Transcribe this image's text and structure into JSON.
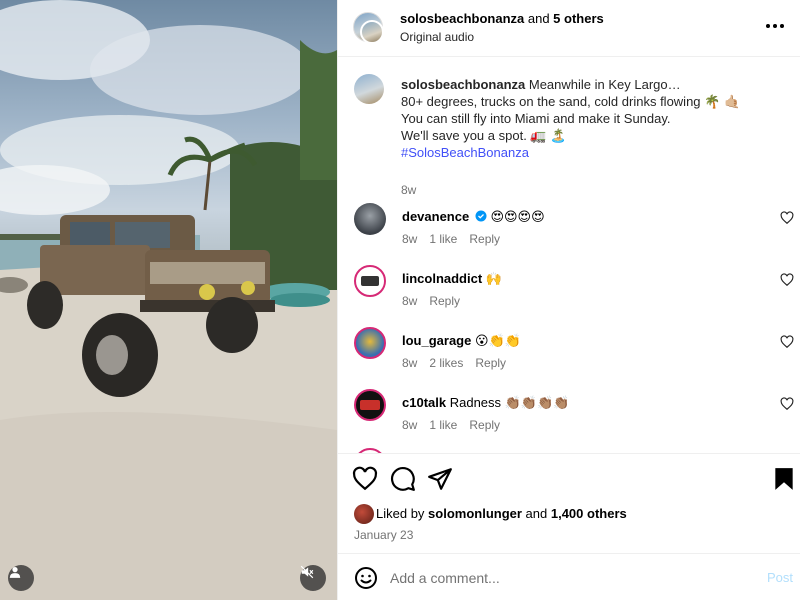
{
  "header": {
    "username": "solosbeachbonanza",
    "and_text": " and ",
    "others": "5 others",
    "audio": "Original audio",
    "more_icon": "more-horizontal-icon"
  },
  "caption": {
    "username": "solosbeachbonanza",
    "lines": [
      "Meanwhile in Key Largo…",
      "80+ degrees, trucks on the sand, cold drinks flowing 🌴 🤙🏼",
      "You can still fly into Miami and make it Sunday.",
      "We'll save you a spot. 🚛 🏝️"
    ],
    "hashtag": "#SolosBeachBonanza",
    "time": "8w"
  },
  "comments": [
    {
      "username": "devanence",
      "verified": true,
      "text": "😍😍😍😍",
      "time": "8w",
      "likes": "1 like",
      "reply": "Reply"
    },
    {
      "username": "lincolnaddict",
      "verified": false,
      "text": "🙌",
      "time": "8w",
      "likes": "",
      "reply": "Reply"
    },
    {
      "username": "lou_garage",
      "verified": false,
      "text": "😮👏👏",
      "time": "8w",
      "likes": "2 likes",
      "reply": "Reply"
    },
    {
      "username": "c10talk",
      "verified": false,
      "text": "Radness 👏🏽👏🏽👏🏽👏🏽",
      "time": "8w",
      "likes": "1 like",
      "reply": "Reply"
    }
  ],
  "actions": {
    "liked_prefix": "Liked by ",
    "liked_user": "solomonlunger",
    "liked_and": " and ",
    "liked_count": "1,400 others",
    "date": "January 23"
  },
  "add_comment": {
    "placeholder": "Add a comment...",
    "post_label": "Post"
  },
  "colors": {
    "link": "#4150f7",
    "post_button_disabled": "#b2dffc",
    "secondary_text": "#737373"
  }
}
